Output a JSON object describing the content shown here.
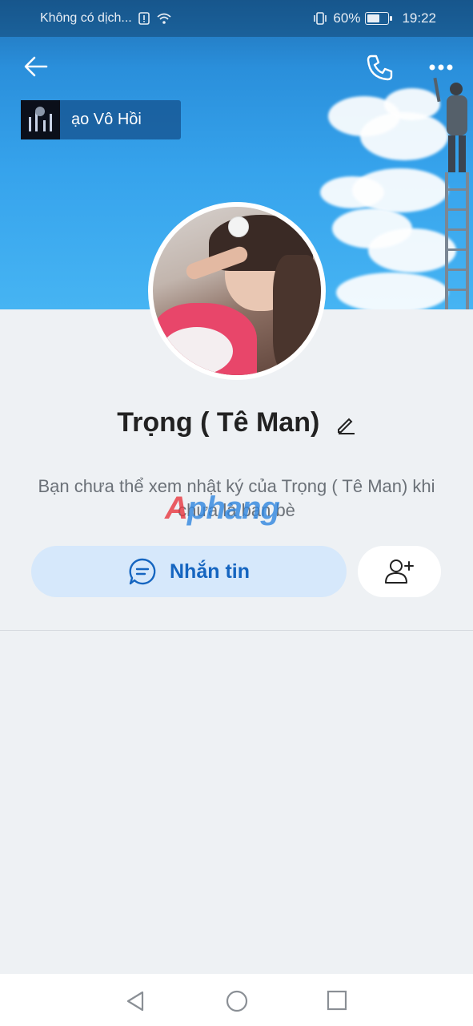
{
  "status_bar": {
    "carrier": "Không có dịch...",
    "battery_percent": "60%",
    "battery_level": 0.6,
    "time": "19:22"
  },
  "header": {
    "back_icon": "arrow-left-icon",
    "call_icon": "phone-icon",
    "more_icon": "more-dots-icon"
  },
  "music_widget": {
    "title": "ạo Vô Hồi"
  },
  "profile": {
    "name": "Trọng ( Tê Man)",
    "edit_icon": "pencil-icon",
    "notice": "Bạn chưa thể xem nhật ký của Trọng ( Tê Man) khi chưa là bạn bè"
  },
  "watermark": {
    "part1": "A",
    "part2": "phang"
  },
  "actions": {
    "message_label": "Nhắn tin",
    "message_icon": "chat-bubble-icon",
    "add_friend_icon": "add-user-icon"
  },
  "nav": {
    "back": "triangle-back-icon",
    "home": "circle-home-icon",
    "recent": "square-recent-icon"
  },
  "colors": {
    "accent": "#1565c0",
    "message_button_bg": "#d6e8fb",
    "cover_sky": "#36a3ec"
  }
}
